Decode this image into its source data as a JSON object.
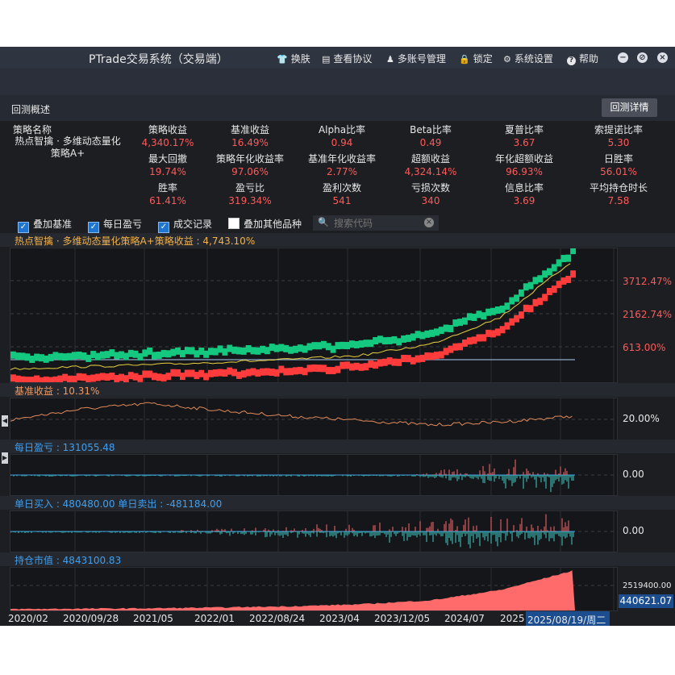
{
  "app": {
    "title": "PTrade交易系统（交易端）",
    "menu": [
      {
        "icon": "shirt-icon",
        "glyph": "👕",
        "label": "换肤"
      },
      {
        "icon": "document-icon",
        "glyph": "▤",
        "label": "查看协议"
      },
      {
        "icon": "multi-user-icon",
        "glyph": "♟",
        "label": "多账号管理"
      },
      {
        "icon": "lock-icon",
        "glyph": "🔒",
        "label": "锁定"
      },
      {
        "icon": "gear-icon",
        "glyph": "⚙",
        "label": "系统设置"
      },
      {
        "icon": "help-icon",
        "glyph": "?",
        "label": "帮助"
      }
    ],
    "window_buttons": {
      "minimize": "−",
      "restore": "⊘",
      "close": "×"
    }
  },
  "overview": {
    "title": "回测概述",
    "detail_button": "回测详情",
    "strategy_name_label": "策略名称",
    "strategy_name": "热点智擒 · 多维动态量化策略A+",
    "metrics": [
      {
        "label": "策略收益",
        "value": "4,340.17%"
      },
      {
        "label": "基准收益",
        "value": "16.49%"
      },
      {
        "label": "Alpha比率",
        "value": "0.94"
      },
      {
        "label": "Beta比率",
        "value": "0.49"
      },
      {
        "label": "夏普比率",
        "value": "3.67"
      },
      {
        "label": "索提诺比率",
        "value": "5.30"
      },
      {
        "label": "最大回撤",
        "value": "19.74%"
      },
      {
        "label": "策略年化收益率",
        "value": "97.06%"
      },
      {
        "label": "基准年化收益率",
        "value": "2.77%"
      },
      {
        "label": "超额收益",
        "value": "4,324.14%"
      },
      {
        "label": "年化超额收益",
        "value": "96.93%"
      },
      {
        "label": "日胜率",
        "value": "56.01%"
      },
      {
        "label": "胜率",
        "value": "61.41%"
      },
      {
        "label": "盈亏比",
        "value": "319.34%"
      },
      {
        "label": "盈利次数",
        "value": "541"
      },
      {
        "label": "亏损次数",
        "value": "340"
      },
      {
        "label": "信息比率",
        "value": "3.69"
      },
      {
        "label": "平均持仓时长",
        "value": "7.58"
      }
    ]
  },
  "options": {
    "checkboxes": [
      {
        "label": "叠加基准",
        "checked": true
      },
      {
        "label": "每日盈亏",
        "checked": true
      },
      {
        "label": "成交记录",
        "checked": true
      },
      {
        "label": "叠加其他品种",
        "checked": false
      }
    ],
    "search_placeholder": "搜索代码"
  },
  "panels": {
    "strategy": {
      "label": "热点智擒 · 多维动态量化策略A+策略收益 : 4,743.10%",
      "ticks": [
        "3712.47%",
        "2162.74%",
        "613.00%"
      ]
    },
    "benchmark": {
      "label": "基准收益 : 10.31%",
      "ticks": [
        "20.00%"
      ]
    },
    "daily_pnl": {
      "label": "每日盈亏 : 131055.48",
      "ticks": [
        "0.00"
      ]
    },
    "trades": {
      "label": "单日买入 : 480480.00  单日卖出 : -481184.00",
      "ticks": [
        "0.00"
      ]
    },
    "holdings": {
      "label": "持仓市值 : 4843100.83",
      "ticks": [
        "2519400.00"
      ],
      "cursor_value": "440621.07"
    }
  },
  "xaxis": {
    "ticks": [
      "2020/02",
      "2020/09/28",
      "2021/05",
      "2022/01",
      "2022/08/24",
      "2023/04",
      "2023/12/05",
      "2024/07",
      "2025"
    ],
    "cursor_date": "2025/08/19/周二"
  },
  "chart_data": [
    {
      "type": "line",
      "title": "热点智擒 · 多维动态量化策略A+策略收益 : 4,743.10%",
      "x": [
        "2020/02",
        "2020/09/28",
        "2021/05",
        "2022/01",
        "2022/08/24",
        "2023/04",
        "2023/12/05",
        "2024/07",
        "2025/08/19"
      ],
      "series": [
        {
          "name": "策略收益",
          "values": [
            0,
            100,
            180,
            300,
            420,
            600,
            1100,
            2300,
            4743.1
          ]
        }
      ],
      "yticks": [
        "613.00%",
        "2162.74%",
        "3712.47%"
      ],
      "colors": {
        "up": "#14c97f",
        "down": "#ff3b3b",
        "line": "#e8d040",
        "benchmark": "#8fa8c8"
      }
    },
    {
      "type": "line",
      "title": "基准收益 : 10.31%",
      "x": [
        "2020/02",
        "2020/09/28",
        "2021/05",
        "2022/01",
        "2022/08/24",
        "2023/04",
        "2023/12/05",
        "2024/07",
        "2025/08/19"
      ],
      "series": [
        {
          "name": "基准收益",
          "values": [
            5,
            20,
            28,
            18,
            10,
            4,
            -2,
            2,
            10.31
          ]
        }
      ],
      "yticks": [
        "20.00%"
      ],
      "colors": {
        "line": "#e08a5a"
      }
    },
    {
      "type": "bar",
      "title": "每日盈亏 : 131055.48",
      "yticks": [
        "0.00"
      ],
      "colors": {
        "up": "#ff6b6b",
        "down": "#3fd0c8"
      }
    },
    {
      "type": "bar",
      "title": "单日买入 : 480480.00  单日卖出 : -481184.00",
      "yticks": [
        "0.00"
      ],
      "colors": {
        "up": "#ff6b6b",
        "down": "#3fd0c8"
      }
    },
    {
      "type": "area",
      "title": "持仓市值 : 4843100.83",
      "x": [
        "2020/02",
        "2020/09/28",
        "2021/05",
        "2022/01",
        "2022/08/24",
        "2023/04",
        "2023/12/05",
        "2024/07",
        "2025/08/19"
      ],
      "series": [
        {
          "name": "持仓市值",
          "values": [
            100000,
            150000,
            200000,
            300000,
            450000,
            700000,
            1200000,
            2500000,
            4843100.83
          ]
        }
      ],
      "yticks": [
        "2519400.00"
      ],
      "colors": {
        "fill": "#ff6b6b"
      }
    }
  ]
}
